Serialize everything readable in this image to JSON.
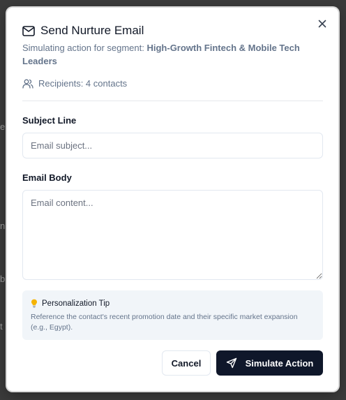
{
  "background": {
    "fragments": [
      "e",
      "n",
      "b",
      "t"
    ]
  },
  "dialog": {
    "close_icon": "close-icon",
    "title_icon": "mail-icon",
    "title": "Send Nurture Email",
    "subtitle_prefix": "Simulating action for segment: ",
    "segment_name": "High-Growth Fintech & Mobile Tech Leaders",
    "recipients_icon": "users-icon",
    "recipients_text": "Recipients: 4 contacts",
    "subject": {
      "label": "Subject Line",
      "value": "",
      "placeholder": "Email subject..."
    },
    "body": {
      "label": "Email Body",
      "value": "",
      "placeholder": "Email content..."
    },
    "tip": {
      "icon": "lightbulb-icon",
      "title": "Personalization Tip",
      "text": "Reference the contact's recent promotion date and their specific market expansion (e.g., Egypt)."
    },
    "actions": {
      "cancel_label": "Cancel",
      "primary_icon": "send-icon",
      "primary_label": "Simulate Action"
    }
  },
  "colors": {
    "overlay": "#3b3b3b",
    "primary_button": "#0f172a",
    "muted_text": "#64748b",
    "tip_background": "#f1f5f9",
    "tip_icon": "#f5b301"
  }
}
